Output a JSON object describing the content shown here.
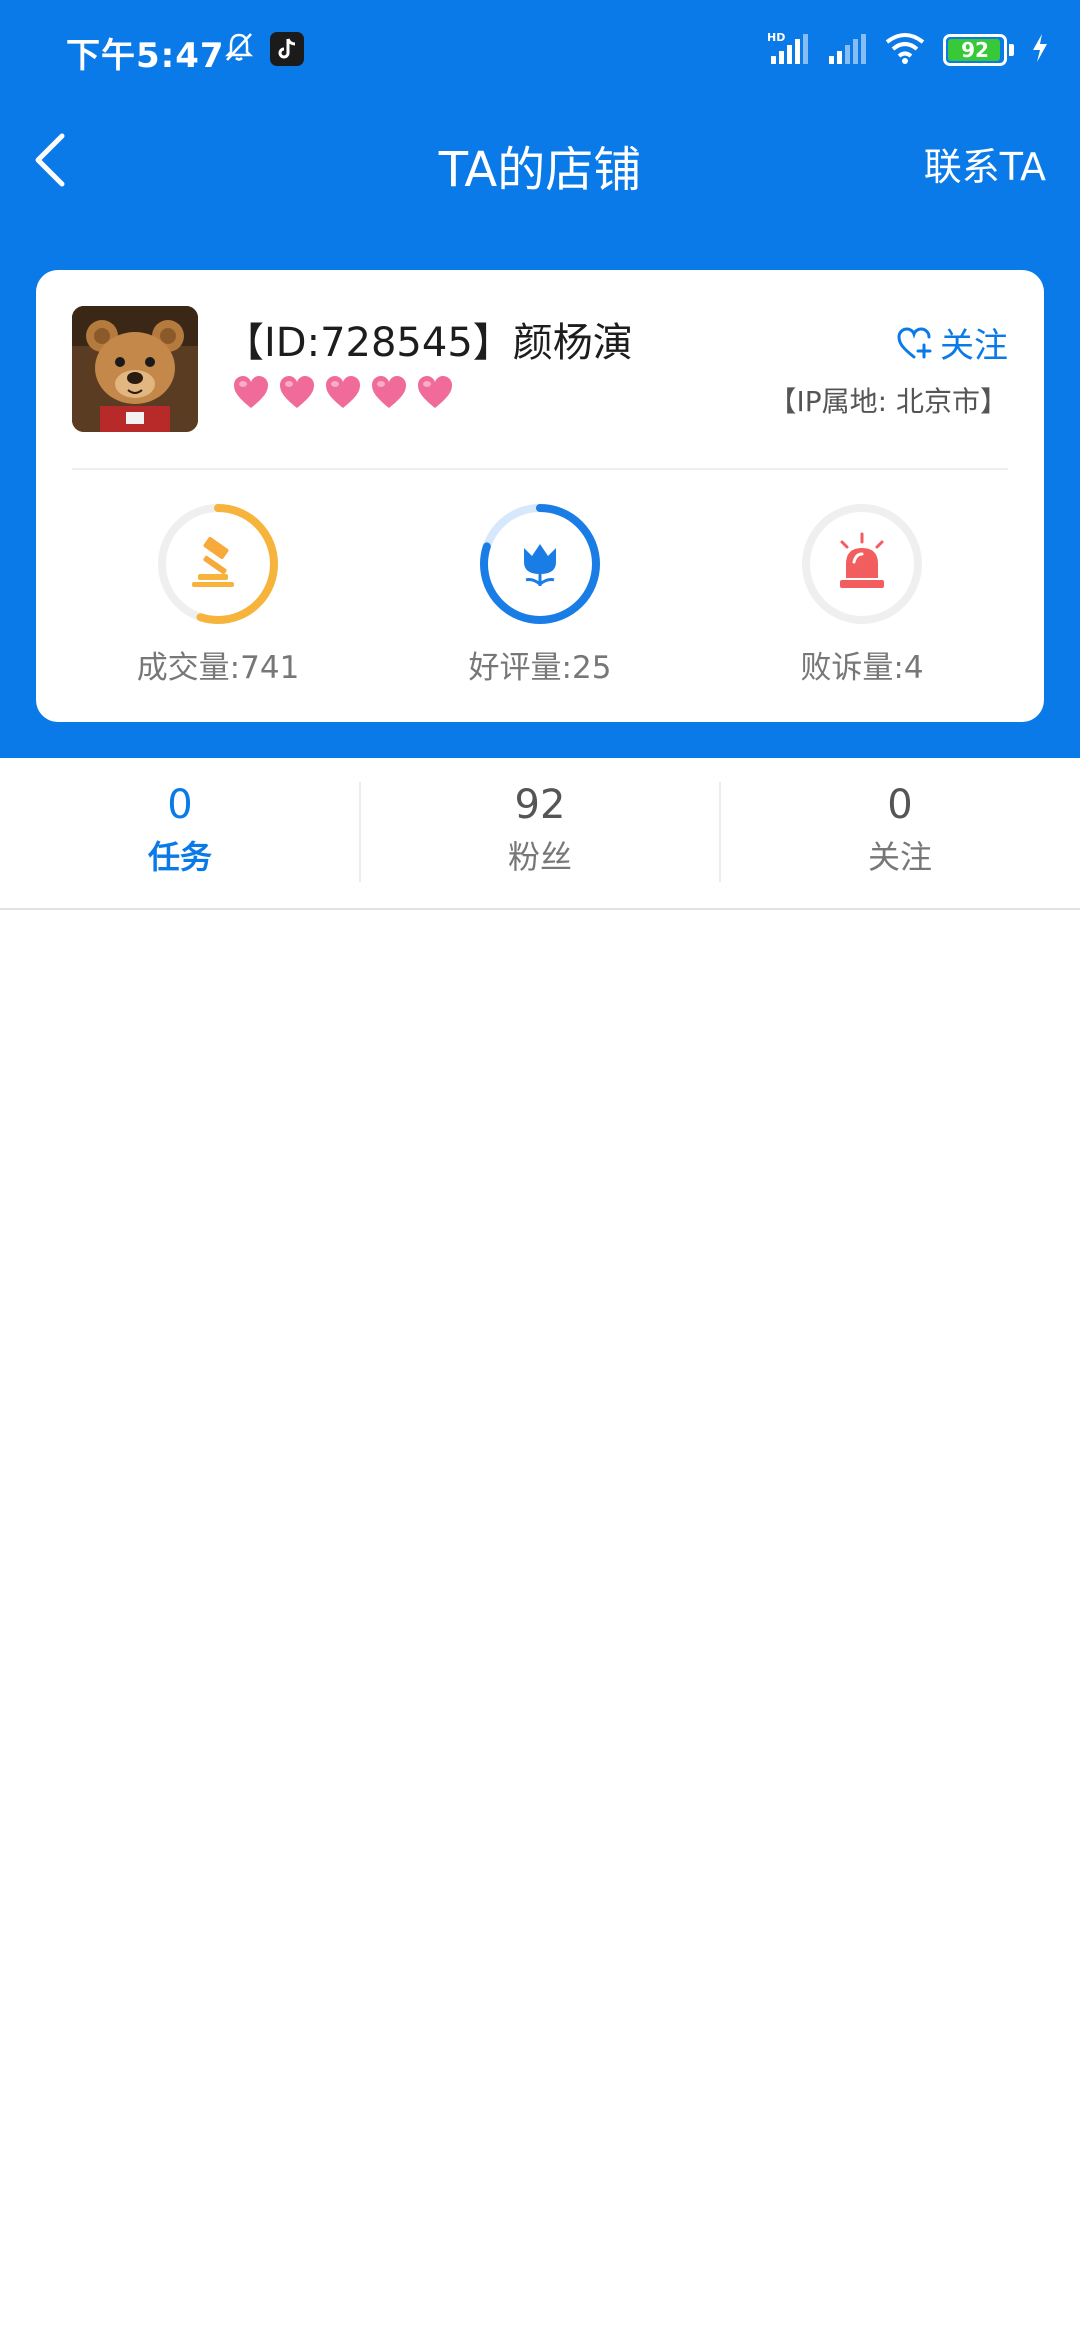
{
  "status_bar": {
    "time": "下午5:47",
    "battery_level": "92",
    "icons": [
      "bell-off-icon",
      "tiktok-icon",
      "hd-signal-icon",
      "signal-icon",
      "wifi-icon",
      "battery-icon",
      "charging-icon"
    ]
  },
  "nav": {
    "title": "TA的店铺",
    "contact_label": "联系TA"
  },
  "profile": {
    "name": "【ID:728545】颜杨演",
    "heart_count": 5,
    "follow_label": "关注",
    "ip_location": "【IP属地: 北京市】"
  },
  "stats": [
    {
      "label": "成交量:741",
      "icon": "gavel-icon",
      "color": "#f7b43c",
      "progress": 0.55
    },
    {
      "label": "好评量:25",
      "icon": "tulip-icon",
      "color": "#1a7de6",
      "progress": 0.8
    },
    {
      "label": "败诉量:4",
      "icon": "alarm-light-icon",
      "color": "#f25d5d",
      "progress": 0.0
    }
  ],
  "tabs": [
    {
      "count": "0",
      "label": "任务",
      "active": true
    },
    {
      "count": "92",
      "label": "粉丝",
      "active": false
    },
    {
      "count": "0",
      "label": "关注",
      "active": false
    }
  ],
  "colors": {
    "brand": "#0a7ae8",
    "heart": "#f06a9a"
  }
}
